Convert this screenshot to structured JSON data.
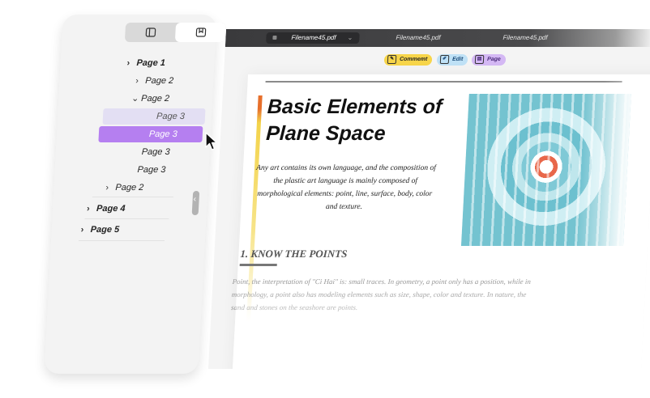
{
  "tabs": [
    {
      "label": "Filename45.pdf",
      "active": true
    },
    {
      "label": "Filename45.pdf",
      "active": false
    },
    {
      "label": "Filename45.pdf",
      "active": false
    }
  ],
  "modes": {
    "comment": "Commemt",
    "edit": "Edit",
    "page": "Page"
  },
  "document": {
    "title_line1": "Basic Elements of",
    "title_line2": "Plane Space",
    "intro": "Any art contains its own language, and the composition of the plastic art language is mainly composed of morphological elements: point, line, surface, body, color and texture.",
    "section_heading": "1. KNOW THE POINTS",
    "paragraph": "Point, the interpretation of \"Ci Hai\" is: small traces. In geometry, a point only has a position, while in morphology, a point also has modeling elements such as size, shape, color and texture. In nature, the sand and stones on the seashore are points."
  },
  "sidebar": {
    "segment_icons": [
      "book-icon",
      "bookmark-icon"
    ],
    "tree": [
      {
        "label": "Page 1",
        "state": "collapsed"
      },
      {
        "label": "Page 2",
        "state": "collapsed"
      },
      {
        "label": "Page 2",
        "state": "expanded"
      },
      {
        "label": "Page 3",
        "state": "hover"
      },
      {
        "label": "Page 3",
        "state": "selected"
      },
      {
        "label": "Page 3",
        "state": "normal"
      },
      {
        "label": "Page 3",
        "state": "normal"
      },
      {
        "label": "Page 2",
        "state": "collapsed"
      },
      {
        "label": "Page 4",
        "state": "collapsed"
      },
      {
        "label": "Page 5",
        "state": "collapsed"
      }
    ]
  },
  "colors": {
    "selected": "#b57ff0",
    "hover": "#e3dff3",
    "comment": "#f7d54a",
    "edit": "#bfe1f6",
    "page": "#d4b8f4",
    "accent": "#e76f2b"
  }
}
